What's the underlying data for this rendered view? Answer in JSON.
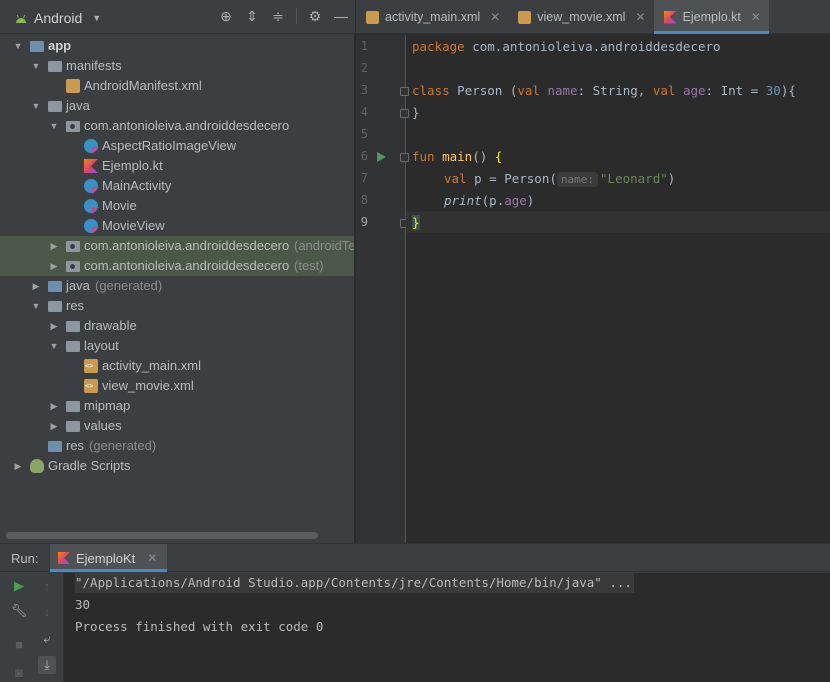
{
  "project_panel": {
    "view_name": "Android",
    "tree": [
      {
        "label": "app",
        "bold": true,
        "depth": 0,
        "arrow": "down",
        "icon": "module-icon"
      },
      {
        "label": "manifests",
        "depth": 1,
        "arrow": "down",
        "icon": "folder-icon"
      },
      {
        "label": "AndroidManifest.xml",
        "depth": 2,
        "icon": "manifest-file-icon"
      },
      {
        "label": "java",
        "depth": 1,
        "arrow": "down",
        "icon": "folder-icon"
      },
      {
        "label": "com.antonioleiva.androiddesdecero",
        "depth": 2,
        "arrow": "down",
        "icon": "package-icon"
      },
      {
        "label": "AspectRatioImageView",
        "depth": 3,
        "icon": "kotlin-class-icon"
      },
      {
        "label": "Ejemplo.kt",
        "depth": 3,
        "icon": "kotlin-file-icon"
      },
      {
        "label": "MainActivity",
        "depth": 3,
        "icon": "kotlin-class-icon"
      },
      {
        "label": "Movie",
        "depth": 3,
        "icon": "kotlin-class-icon"
      },
      {
        "label": "MovieView",
        "depth": 3,
        "icon": "kotlin-class-icon"
      },
      {
        "label": "com.antonioleiva.androiddesdecero",
        "suffix": "(androidTest)",
        "depth": 2,
        "arrow": "right",
        "icon": "package-icon",
        "selected": true
      },
      {
        "label": "com.antonioleiva.androiddesdecero",
        "suffix": "(test)",
        "depth": 2,
        "arrow": "right",
        "icon": "package-icon",
        "selected": true
      },
      {
        "label": "java",
        "suffix": "(generated)",
        "depth": 1,
        "arrow": "right",
        "icon": "generated-folder-icon"
      },
      {
        "label": "res",
        "depth": 1,
        "arrow": "down",
        "icon": "folder-icon"
      },
      {
        "label": "drawable",
        "depth": 2,
        "arrow": "right",
        "icon": "folder-icon"
      },
      {
        "label": "layout",
        "depth": 2,
        "arrow": "down",
        "icon": "folder-icon"
      },
      {
        "label": "activity_main.xml",
        "depth": 3,
        "icon": "xml-file-icon"
      },
      {
        "label": "view_movie.xml",
        "depth": 3,
        "icon": "xml-file-icon"
      },
      {
        "label": "mipmap",
        "depth": 2,
        "arrow": "right",
        "icon": "folder-icon"
      },
      {
        "label": "values",
        "depth": 2,
        "arrow": "right",
        "icon": "folder-icon"
      },
      {
        "label": "res",
        "suffix": "(generated)",
        "depth": 1,
        "icon": "generated-folder-icon"
      },
      {
        "label": "Gradle Scripts",
        "depth": 0,
        "arrow": "right",
        "icon": "gradle-icon"
      }
    ]
  },
  "editor_tabs": [
    {
      "label": "activity_main.xml",
      "icon": "xml-file-icon",
      "active": false
    },
    {
      "label": "view_movie.xml",
      "icon": "xml-file-icon",
      "active": false
    },
    {
      "label": "Ejemplo.kt",
      "icon": "kotlin-file-icon",
      "active": true
    }
  ],
  "editor": {
    "line_numbers": [
      "1",
      "2",
      "3",
      "4",
      "5",
      "6",
      "7",
      "8",
      "9"
    ],
    "current_line": "9",
    "code": {
      "l1_kw": "package",
      "l1_rest": " com.antonioleiva.androiddesdecero",
      "l3_kw": "class",
      "l3_name": " Person (",
      "l3_val1": "val",
      "l3_p1": " name",
      "l3_t1": ": String, ",
      "l3_val2": "val",
      "l3_p2": " age",
      "l3_t2": ": Int = ",
      "l3_num": "30",
      "l3_end": "){",
      "l4": "}",
      "l6_kw": "fun",
      "l6_fn": " main",
      "l6_paren": "() ",
      "l6_brace": "{",
      "l7_kw": "val",
      "l7_mid": " p = Person(",
      "l7_hint": "name:",
      "l7_str": "\"Leonard\"",
      "l7_end": ")",
      "l8_fn": "print",
      "l8_mid": "(p.",
      "l8_prop": "age",
      "l8_end": ")",
      "l9": "}"
    }
  },
  "run_panel": {
    "label": "Run:",
    "tab_label": "EjemploKt",
    "output": [
      "\"/Applications/Android Studio.app/Contents/jre/Contents/Home/bin/java\" ...",
      "30",
      "Process finished with exit code 0"
    ]
  },
  "colors": {
    "panel_bg": "#3c3f41",
    "editor_bg": "#2b2b2b",
    "selection": "#4b5747",
    "accent": "#4a88c7",
    "keyword": "#cc7832",
    "function": "#ffc66d",
    "string": "#6a8759",
    "number": "#6897bb",
    "property": "#9876aa"
  }
}
